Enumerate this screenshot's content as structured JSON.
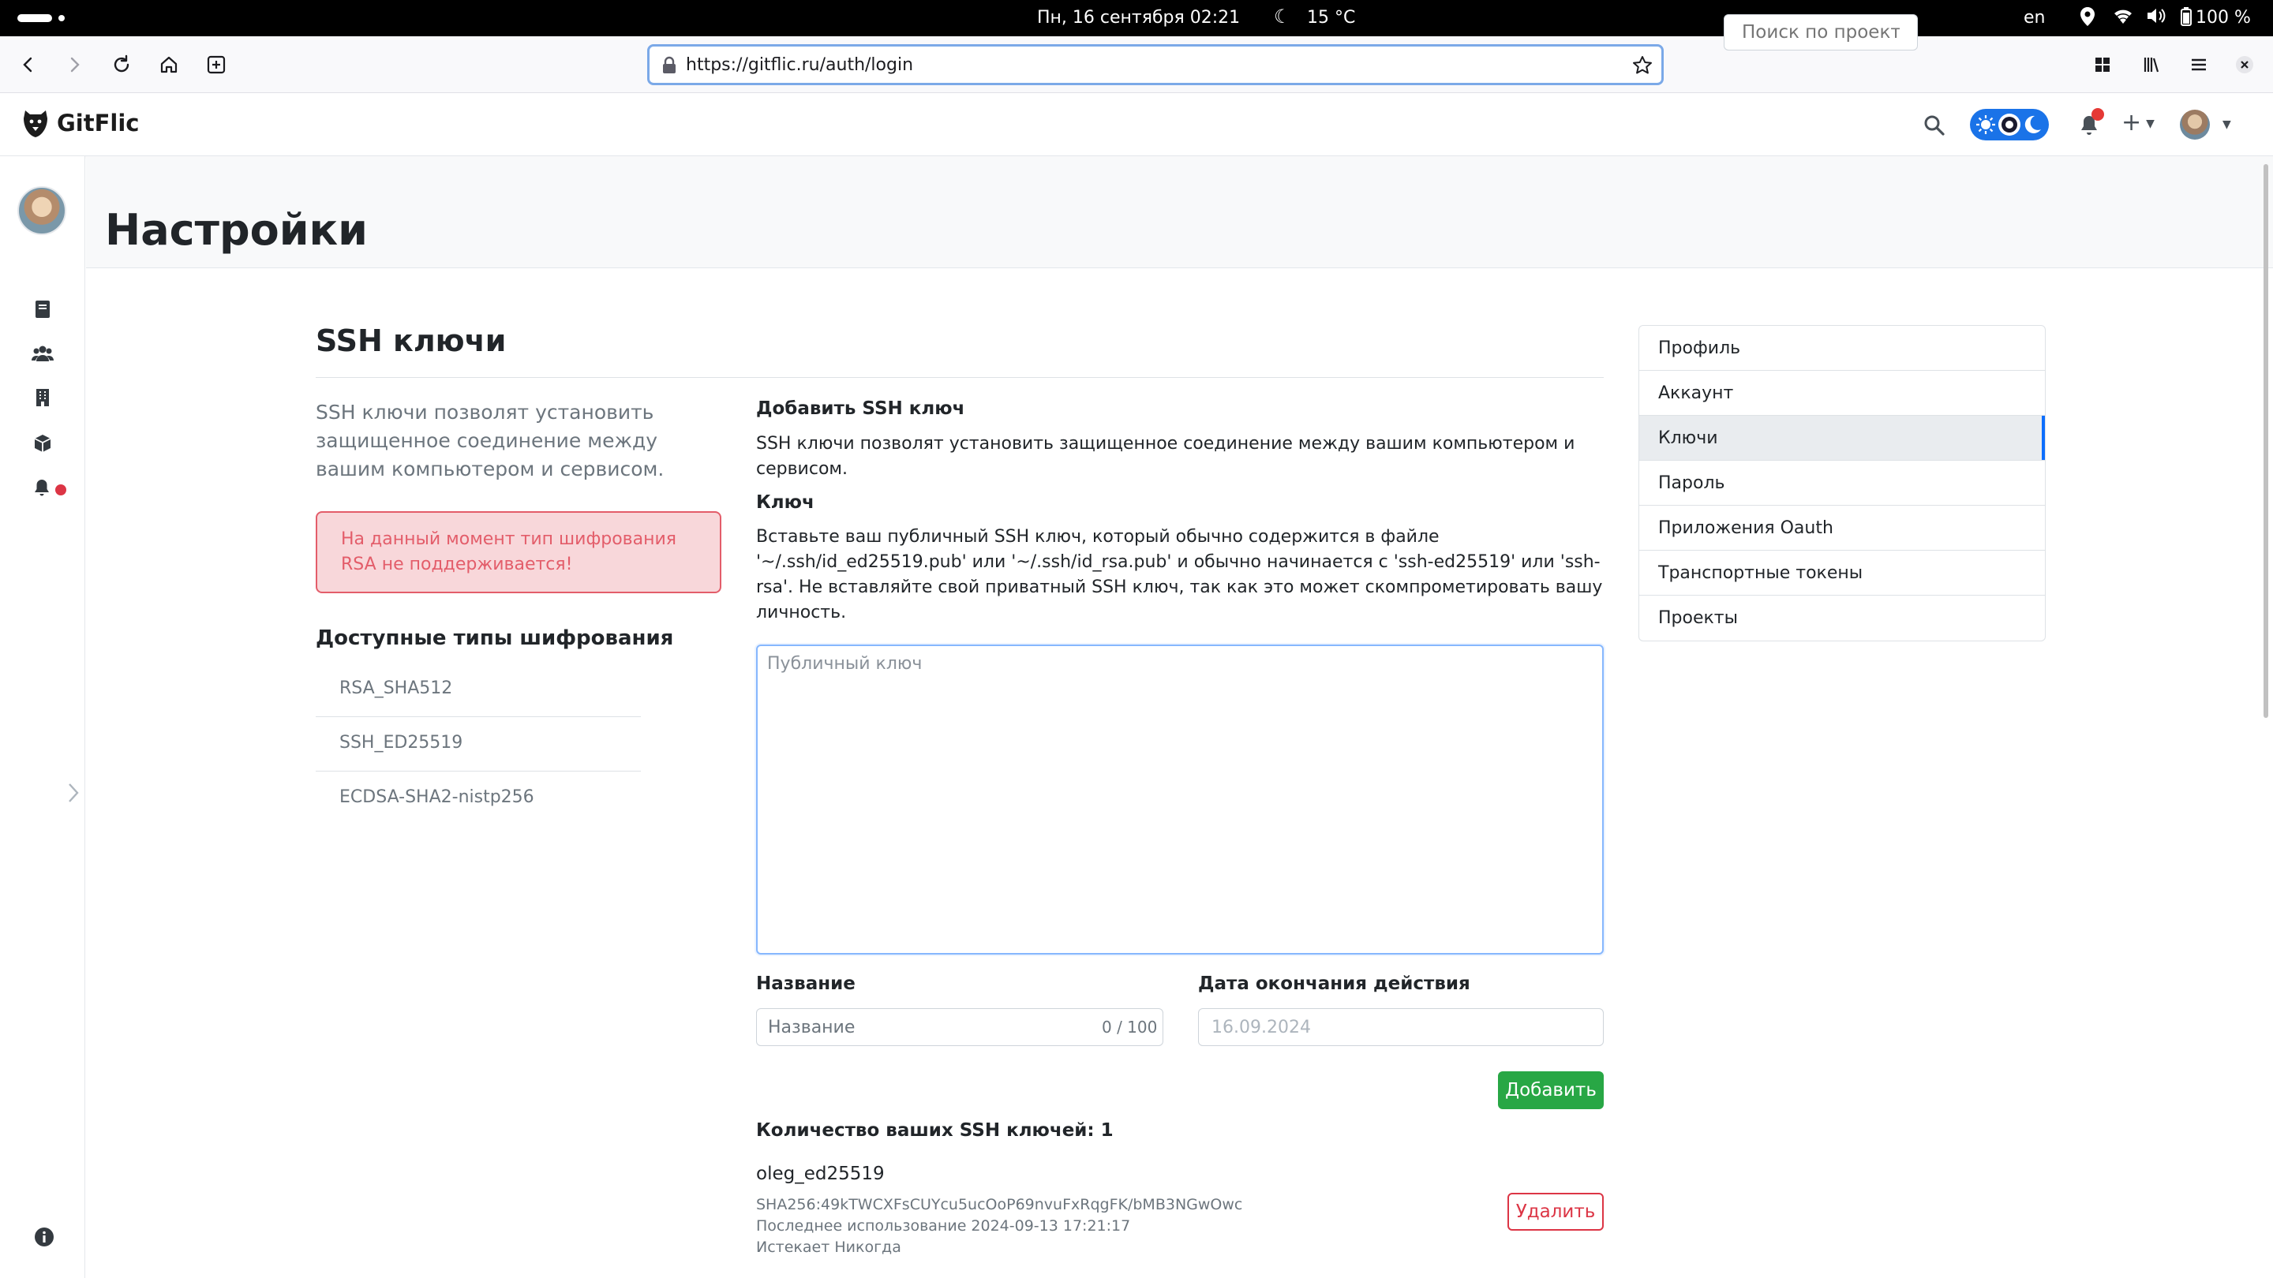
{
  "os": {
    "clock": "Пн, 16 сентября  02:21",
    "weather": "15 °C",
    "lang": "en",
    "battery": "100 %"
  },
  "browser": {
    "url": "https://gitflic.ru/auth/login"
  },
  "header": {
    "logo_text": "GitFlic",
    "search_placeholder": "Поиск по проекту",
    "accent_color": "#1a73e8",
    "notification_color": "#e53935"
  },
  "page": {
    "title": "Настройки"
  },
  "ssh": {
    "section_title": "SSH ключи",
    "intro": "SSH ключи позволят установить защищенное соединение между вашим компьютером и сервисом.",
    "alert": "На данный момент тип шифрования RSA не поддерживается!",
    "available_title": "Доступные типы шифрования",
    "encryption_types": [
      "RSA_SHA512",
      "SSH_ED25519",
      "ECDSA-SHA2-nistp256"
    ],
    "add_title": "Добавить SSH ключ",
    "add_desc": "SSH ключи позволят установить защищенное соединение между вашим компьютером и сервисом.",
    "key_label": "Ключ",
    "key_desc": "Вставьте ваш публичный SSH ключ, который обычно содержится в файле '~/.ssh/id_ed25519.pub' или '~/.ssh/id_rsa.pub' и обычно начинается с 'ssh-ed25519' или 'ssh-rsa'. Не вставляйте свой приватный SSH ключ, так как это может скомпрометировать вашу личность.",
    "key_placeholder": "Публичный ключ",
    "name_label": "Название",
    "name_placeholder": "Название",
    "name_counter": "0 / 100",
    "date_label": "Дата окончания действия",
    "date_value": "16.09.2024",
    "add_button": "Добавить",
    "count_title": "Количество ваших SSH ключей: 1",
    "keys": [
      {
        "name": "oleg_ed25519",
        "fingerprint": "SHA256:49kTWCXFsCUYcu5ucOoP69nvuFxRqgFK/bMB3NGwOwc",
        "last_used": "Последнее использование 2024-09-13 17:21:17",
        "expires": "Истекает Никогда",
        "delete_button": "Удалить"
      }
    ]
  },
  "settings_nav": {
    "items": [
      "Профиль",
      "Аккаунт",
      "Ключи",
      "Пароль",
      "Приложения Oauth",
      "Транспортные токены",
      "Проекты"
    ],
    "active": "Ключи"
  }
}
